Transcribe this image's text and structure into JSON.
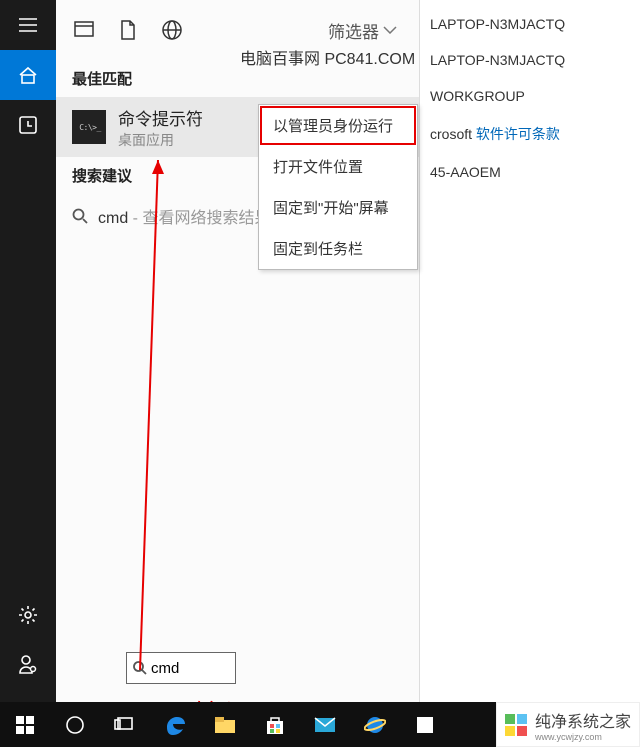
{
  "search": {
    "filter_label": "筛选器",
    "section_best_match": "最佳匹配",
    "best_match": {
      "title": "命令提示符",
      "subtitle": "桌面应用",
      "icon_text": "C:\\>_"
    },
    "section_suggestions": "搜索建议",
    "suggestion_prefix": "cmd",
    "suggestion_tail": " - 查看网络搜索结果",
    "input_value": "cmd"
  },
  "context_menu": {
    "items": [
      "以管理员身份运行",
      "打开文件位置",
      "固定到\"开始\"屏幕",
      "固定到任务栏"
    ]
  },
  "right_panel": {
    "lines": [
      "LAPTOP-N3MJACTQ",
      "LAPTOP-N3MJACTQ",
      "WORKGROUP"
    ],
    "link_prefix": "crosoft ",
    "link_text": "软件许可条款",
    "product_id_tail": "45-AAOEM"
  },
  "watermark": "电脑百事网 PC841.COM",
  "annotations": {
    "input_label": "输入cmd"
  },
  "brand": {
    "name": "纯净系统之家",
    "url": "www.ycwjzy.com"
  }
}
